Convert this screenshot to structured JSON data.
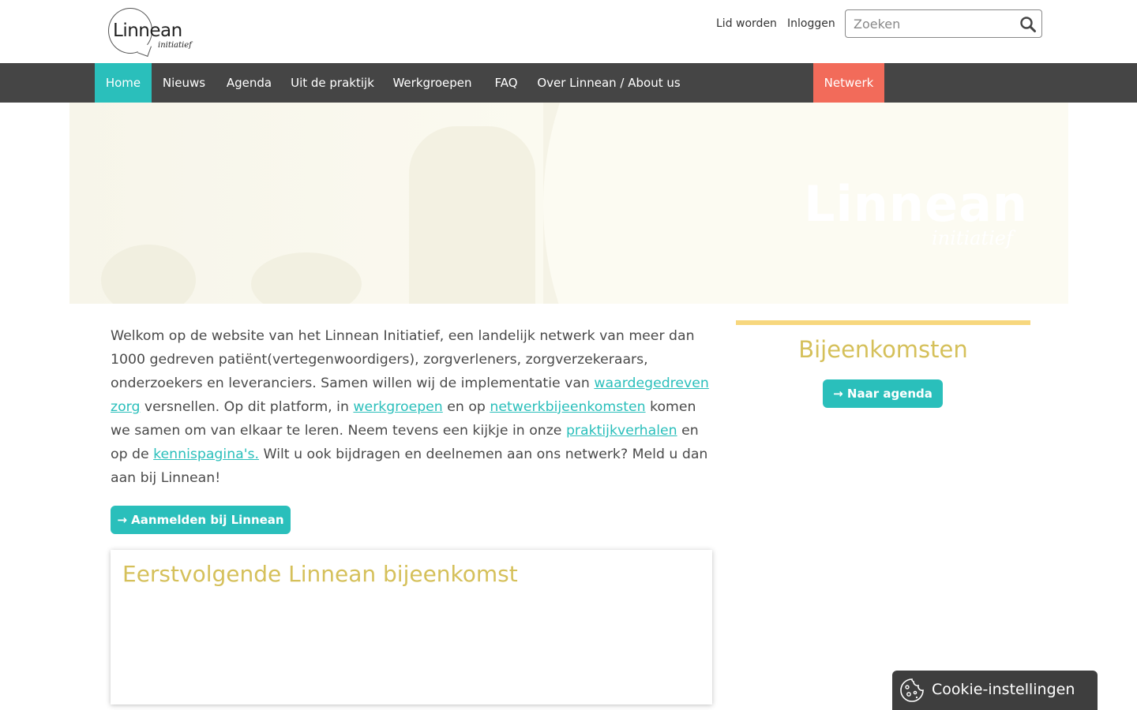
{
  "header": {
    "logo": {
      "word": "Linnean",
      "sub": "initiatief"
    },
    "links": {
      "join": "Lid worden",
      "login": "Inloggen"
    },
    "search": {
      "placeholder": "Zoeken"
    }
  },
  "nav": {
    "items": [
      {
        "label": "Home"
      },
      {
        "label": "Nieuws"
      },
      {
        "label": "Agenda"
      },
      {
        "label": "Uit de praktijk"
      },
      {
        "label": "Werkgroepen"
      },
      {
        "label": "FAQ"
      },
      {
        "label": "Over Linnean / About us"
      }
    ],
    "network": "Netwerk"
  },
  "hero": {
    "logo_word": "Linnean",
    "logo_sub": "initiatief"
  },
  "intro": {
    "t1": "Welkom op de website van het Linnean Initiatief, een landelijk netwerk van meer dan 1000 gedreven patiënt(vertegenwoordigers), zorgverleners, zorgverzekeraars, onderzoekers en leveranciers. Samen willen wij de implementatie van ",
    "link1": "waardegedreven zorg",
    "t2": " versnellen. Op dit platform, in ",
    "link2": "werkgroepen",
    "t3": " en op ",
    "link3": "netwerkbijeenkomsten",
    "t4": " komen we samen om van elkaar te leren. Neem tevens een kijkje in onze ",
    "link4": "praktijkverhalen",
    "t5": " en op de ",
    "link5": "kennispagina's.",
    "t6": " Wilt u ook bijdragen en deelnemen aan ons netwerk? Meld u dan aan bij Linnean!"
  },
  "signup_button": "→ Aanmelden bij Linnean",
  "next_event": {
    "title": "Eerstvolgende Linnean bijeenkomst"
  },
  "sidebar": {
    "title": "Bijeenkomsten",
    "agenda_button": "→ Naar agenda"
  },
  "cookie": {
    "label": "Cookie-instellingen"
  },
  "colors": {
    "teal": "#2abfbb",
    "coral": "#f26b5a",
    "gold": "#d5c05a",
    "nav_bg": "#454545"
  }
}
